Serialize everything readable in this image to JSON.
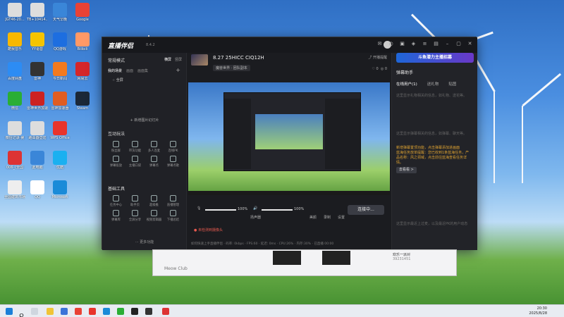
{
  "desktop": {
    "icons": [
      {
        "label": "JGT46-20...\n建筑与市政...",
        "color": "#ddd"
      },
      {
        "label": "酷我音乐",
        "color": "#f8b800"
      },
      {
        "label": "百度网盘",
        "color": "#2c8cf4"
      },
      {
        "label": "微信",
        "color": "#2aae35"
      },
      {
        "label": "微信记录-第\n四方大楼",
        "color": "#ddd"
      },
      {
        "label": "006_(全国\n法院...)",
        "color": "#d33"
      },
      {
        "label": "全国建筑市场\n监管公共...",
        "color": "#eee"
      },
      {
        "label": "TB+10414...\n铁路隧道...",
        "color": "#ddd"
      },
      {
        "label": "YY语音",
        "color": "#f5c400"
      },
      {
        "label": "雷神",
        "color": "#333"
      },
      {
        "label": "雷神世界加速\n器",
        "color": "#c22"
      },
      {
        "label": "路由器登陆\n上网设置",
        "color": "#ddd"
      },
      {
        "label": "此电脑",
        "color": "#3a86d8"
      },
      {
        "label": "QQ",
        "color": "#fff"
      },
      {
        "label": "天气早晚\n新手入门",
        "color": "#3a86d8"
      },
      {
        "label": "QQ游戏",
        "color": "#1d6ee0"
      },
      {
        "label": "今日新闻",
        "color": "#f37a1f"
      },
      {
        "label": "雷神加速器",
        "color": "#e05d22"
      },
      {
        "label": "WPS Office",
        "color": "#e8342b"
      },
      {
        "label": "优酷",
        "color": "#1ab0f0"
      },
      {
        "label": "Microsoft\nEdge",
        "color": "#1a8bd8"
      },
      {
        "label": "Google\nChrome",
        "color": "#e94235"
      },
      {
        "label": "Bilibili",
        "color": "#f96"
      },
      {
        "label": "网易云",
        "color": "#d4262a"
      },
      {
        "label": "Steam",
        "color": "#1b2838"
      }
    ]
  },
  "app": {
    "name": "直播伴侣",
    "version": "8.4.2",
    "left": {
      "mode_label": "常规模式",
      "mode_tabs": [
        "横屏",
        "竖屏"
      ],
      "tabs": [
        "我的场景",
        "画面",
        "画面集"
      ],
      "scene_name": "全屏",
      "add_scene": "+ 新增图片幻灯片",
      "interactive_title": "互动玩法",
      "interactive_tools": [
        "粉丝群",
        "带货功能",
        "多人连麦",
        "连线PK",
        "弹幕投放",
        "主播口袋",
        "弹幕点",
        "弹幕点歌"
      ],
      "basic_title": "基础工具",
      "basic_tools": [
        "任务中心",
        "助手页",
        "超级推",
        "直播管理",
        "弹幕库",
        "全屏分享",
        "视频剪辑器",
        "下播总结"
      ],
      "more": "··· 更多功能"
    },
    "center": {
      "title": "8.27 25HICC CIQ12H",
      "tag": "魔兽世界 · 团队副本",
      "share": "开播提醒",
      "stats": [
        "0",
        "0"
      ],
      "mic_label": "话筒",
      "mic_pct": "100%",
      "speaker_label": "扬声器",
      "speaker_pct": "100%",
      "actions": [
        "美颜",
        "录制",
        "设置"
      ],
      "start_button": "连接中...",
      "warning": "未检测到摄像头",
      "status": "如何快速上手直播伴侣  ·  码率: 0kbps  ·  FPS:60  ·  延迟: 0ms  ·  CPU:26%  ·  内存:30%  ·  已直播 00:00"
    },
    "right": {
      "promo": "斗鱼潜力主播招募",
      "title": "弹幕助手",
      "tabs": [
        "在线用户(1)",
        "送礼物",
        "贴图"
      ],
      "text1": "这里显示礼物相关的信息，如礼物、送花等。",
      "text2": "这里显示弹幕相关的信息，如弹幕、聊天等。",
      "highlight": "新增弹幕置顶功能，点击弹幕添加进画面",
      "highlight2": "蓝海任务放单提醒：您已收到1条蓝海任务，产品名称：风之领域，点击前往蓝海查看任务详情。",
      "link": "去看看 >",
      "text3": "这里显示最近上过麦，以及最近PK的用户动态"
    }
  },
  "club": {
    "title": "Meow Club",
    "status": "欢乐一派对",
    "count": "39231451"
  },
  "taskbar": {
    "time": "20:30",
    "date": "2025/8/28"
  }
}
